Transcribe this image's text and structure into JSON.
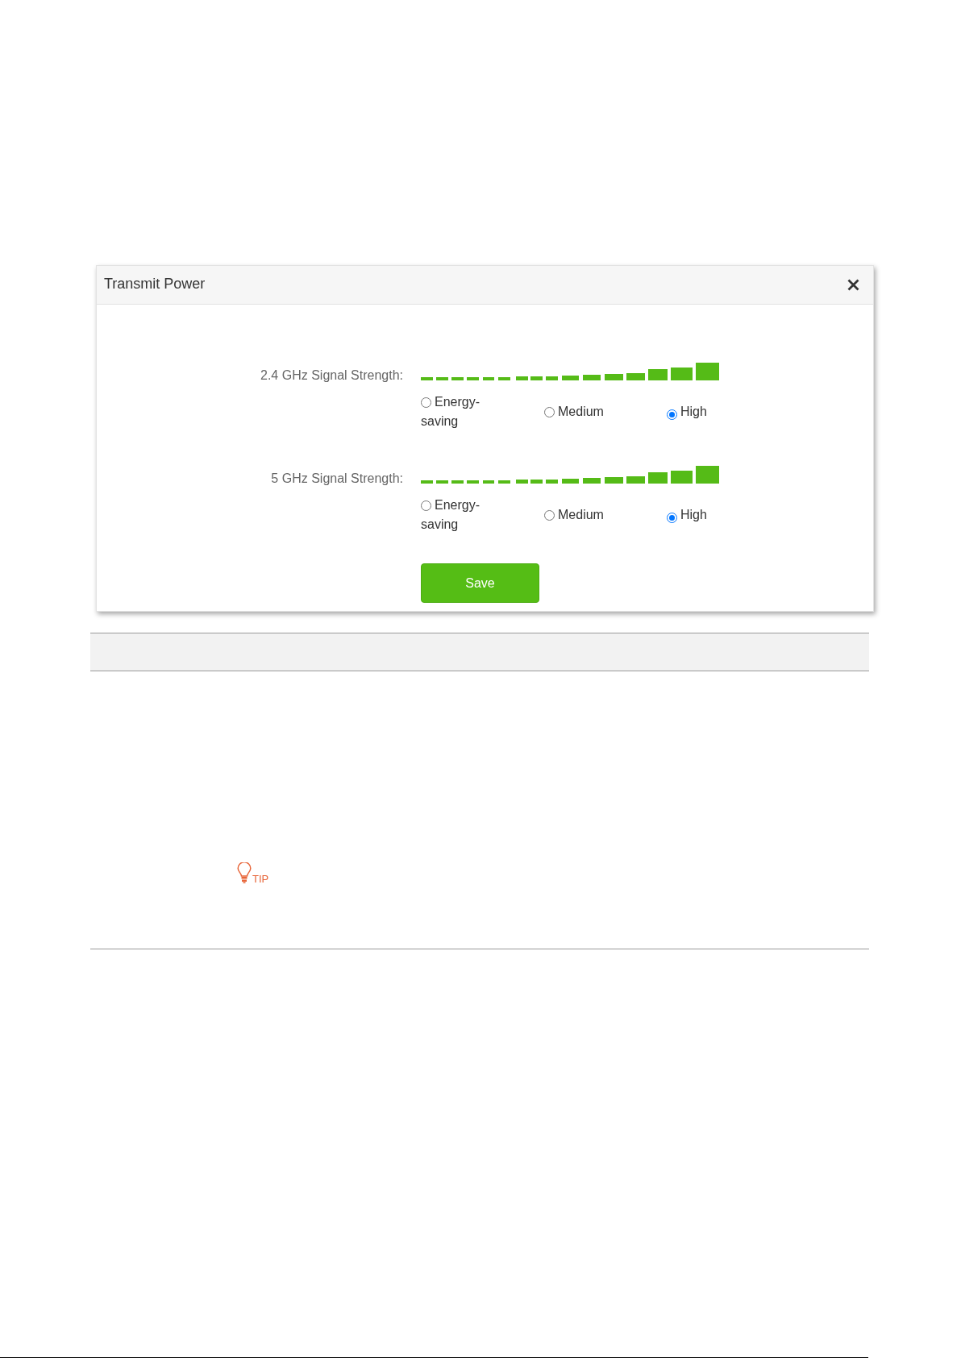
{
  "dialog": {
    "title": "Transmit Power",
    "bands": [
      {
        "label": "2.4 GHz Signal Strength:",
        "options": [
          {
            "label": "Energy-saving",
            "selected": false
          },
          {
            "label": "Medium",
            "selected": false
          },
          {
            "label": "High",
            "selected": true
          }
        ]
      },
      {
        "label": "5 GHz Signal Strength:",
        "options": [
          {
            "label": "Energy-saving",
            "selected": false
          },
          {
            "label": "Medium",
            "selected": false
          },
          {
            "label": "High",
            "selected": true
          }
        ]
      }
    ],
    "save_button": "Save"
  },
  "tip": {
    "label": "TIP"
  }
}
